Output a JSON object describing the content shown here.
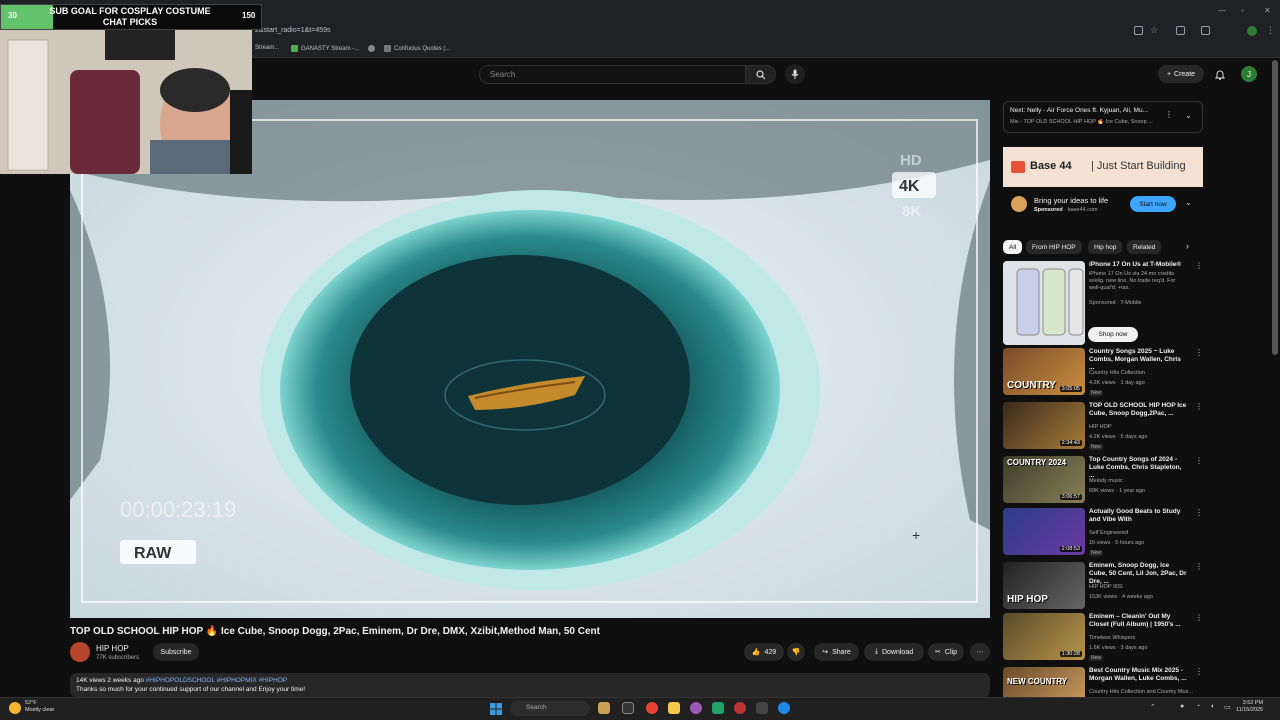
{
  "browser": {
    "url": "2&start_radio=1&t=459s",
    "bookmarks": [
      "Stream...",
      "GANASTY Stream -...",
      "Confucius Quotes (..."
    ]
  },
  "overlay": {
    "left_value": "30",
    "title": "SUB GOAL FOR COSPLAY COSTUME CHAT PICKS",
    "right_value": "150",
    "progress": 0.2
  },
  "header": {
    "search_placeholder": "Search",
    "create_label": "Create",
    "avatar_letter": "J"
  },
  "video": {
    "timecode": "00:00:23:19",
    "raw_label": "RAW",
    "res_labels": [
      "HD",
      "4K",
      "8K"
    ],
    "title": "TOP OLD SCHOOL HIP HOP 🔥 Ice Cube, Snoop Dogg, 2Pac, Eminem, Dr Dre, DMX, Xzibit,Method Man, 50 Cent",
    "channel": "HIP HOP",
    "subscribers": "77K subscribers",
    "subscribe_label": "Subscribe",
    "likes": "429",
    "share_label": "Share",
    "download_label": "Download",
    "clip_label": "Clip",
    "views_time": "14K views  2 weeks ago",
    "hashtags": "#HIPHOPOLDSCHOOL #HIPHOPMIX #HIPHOP",
    "description": "Thanks so much for your continued support of our channel and Enjoy your time!"
  },
  "next": {
    "title": "Next: Nelly - Air Force Ones ft. Kyjuan, Ali, Mu...",
    "subtitle": "Mix - TOP OLD SCHOOL HIP HOP 🔥 Ice Cube, Snoop ..."
  },
  "ad": {
    "brand": "Base 44",
    "tagline": "|  Just Start Building",
    "line1": "Bring your ideas to life",
    "sponsored": "Sponsored",
    "domain": "· base44.com",
    "cta": "Start now"
  },
  "chips": [
    "All",
    "From HIP HOP",
    "Hip hop",
    "Related"
  ],
  "recs": [
    {
      "title": "iPhone 17 On Us at T-Mobile®",
      "line2": "iPhone 17 On Us via 24 mo credits w/elig. new line. No trade req'd. For well-qual'd; +tax.",
      "line3": "Sponsored · T-Mobile",
      "cta": "Shop now"
    },
    {
      "title": "Country Songs 2025 ~ Luke Combs, Morgan Wallen, Chris ...",
      "channel": "Country Hits Collection",
      "meta": "4.2K views · 1 day ago",
      "badge": "New",
      "duration": "3:05:05",
      "thumb_text": "COUNTRY"
    },
    {
      "title": "TOP OLD SCHOOL HIP HOP Ice Cube, Snoop Dogg,2Pac, ...",
      "channel": "HIP HOP",
      "meta": "4.2K views · 5 days ago",
      "badge": "New",
      "duration": "2:34:43",
      "thumb_text": ""
    },
    {
      "title": "Top Country Songs of 2024 - Luke Combs, Chris Stapleton, ...",
      "channel": "Melody music",
      "meta": "69K views · 1 year ago",
      "badge": "",
      "duration": "3:06:57",
      "thumb_text": "COUNTRY 2024"
    },
    {
      "title": "Actually Good Beats to Study and Vibe With",
      "channel": "Self Engineered",
      "meta": "16 views · 5 hours ago",
      "badge": "New",
      "duration": "2:08:53",
      "thumb_text": ""
    },
    {
      "title": "Eminem, Snoop Dogg, Ice Cube, 50 Cent, Lil Jon, 2Pac, Dr Dre, ...",
      "channel": "HIP HOP 90S",
      "meta": "153K views · 4 weeks ago",
      "badge": "",
      "duration": "",
      "thumb_text": "HIP HOP"
    },
    {
      "title": "Eminem – Cleanin' Out My Closet (Full Album) | 1950's ...",
      "channel": "Timeless Whispers",
      "meta": "1.6K views · 3 days ago",
      "badge": "New",
      "duration": "1:30:28",
      "thumb_text": ""
    },
    {
      "title": "Best Country Music Mix 2025 - Morgan Wallen, Luke Combs, ...",
      "channel": "Country Hits Collection and Country Mus...",
      "meta": "",
      "badge": "",
      "duration": "",
      "thumb_text": "NEW COUNTRY"
    }
  ],
  "taskbar": {
    "weather_temp": "52°F",
    "weather_desc": "Mostly clear",
    "search": "Search",
    "time": "3:52 PM",
    "date": "11/15/2025"
  }
}
